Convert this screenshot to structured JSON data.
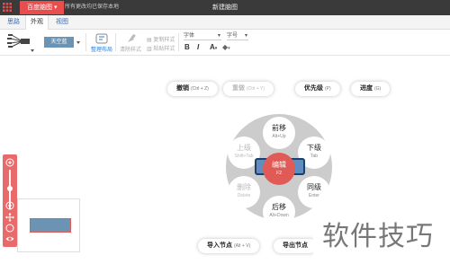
{
  "titlebar": {
    "app_name": "百度脑图",
    "save_status": "所有更改均已保存本地",
    "document_title": "新建脑图"
  },
  "tabs": [
    {
      "label": "思路",
      "active": false
    },
    {
      "label": "外观",
      "active": true
    },
    {
      "label": "视图",
      "active": false
    }
  ],
  "toolbar": {
    "theme_label": "天空蓝",
    "arrange_label": "整理布局",
    "clear_style_label": "清除样式",
    "copy_style_label": "复制样式",
    "paste_style_label": "粘贴样式",
    "font_family_label": "字体",
    "font_size_label": "字号",
    "bold_label": "B",
    "italic_label": "I",
    "font_color_label": "A",
    "highlight_label": "◆"
  },
  "top_hints": [
    {
      "key": "撤销",
      "shortcut": "(Ctrl + Z)",
      "enabled": true
    },
    {
      "key": "重做",
      "shortcut": "(Ctrl + Y)",
      "enabled": false
    },
    {
      "key": "优先级",
      "shortcut": "(P)",
      "enabled": true
    },
    {
      "key": "进度",
      "shortcut": "(G)",
      "enabled": true
    }
  ],
  "radial_menu": {
    "center": {
      "key": "编辑",
      "shortcut": "F2"
    },
    "items": {
      "top": {
        "key": "前移",
        "shortcut": "Alt+Up",
        "enabled": true
      },
      "right_upper": {
        "key": "下级",
        "shortcut": "Tab",
        "enabled": true
      },
      "right_lower": {
        "key": "同级",
        "shortcut": "Enter",
        "enabled": true
      },
      "bottom": {
        "key": "后移",
        "shortcut": "Alt+Down",
        "enabled": true
      },
      "left_lower": {
        "key": "删除",
        "shortcut": "Delete",
        "enabled": false
      },
      "left_upper": {
        "key": "上级",
        "shortcut": "Shift+Tab",
        "enabled": false
      }
    }
  },
  "bottom_hints": [
    {
      "key": "导入节点",
      "shortcut": "(Alt + V)"
    },
    {
      "key": "导出节点",
      "shortcut": ""
    }
  ],
  "watermark": "软件技巧",
  "colors": {
    "accent_red": "#e94d4d",
    "node_blue": "#5f8dc0",
    "link_blue": "#2e7dd6"
  },
  "icons": {
    "app_menu": "grid-icon",
    "structure": "mindmap-structure-icon",
    "zoom_in": "zoom-in-icon",
    "zoom_out": "zoom-out-icon",
    "move": "move-icon",
    "locate": "locate-icon",
    "preview": "eye-icon"
  }
}
